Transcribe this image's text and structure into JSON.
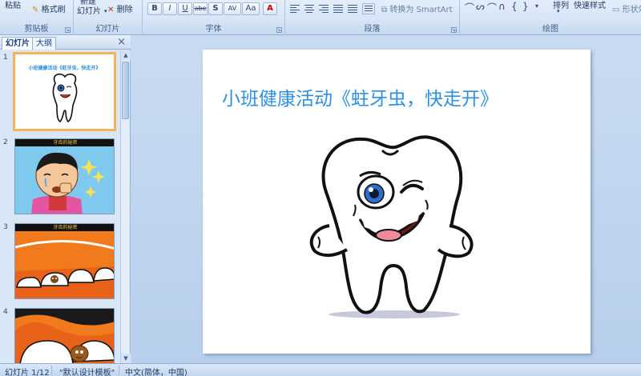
{
  "ribbon": {
    "clipboard": {
      "paste_label": "粘贴",
      "format_painter_label": "格式刷",
      "group_label": "剪贴板"
    },
    "slides": {
      "new_slide_label": "新建",
      "new_slide_label2": "幻灯片",
      "delete_label": "删除",
      "group_label": "幻灯片"
    },
    "font": {
      "group_label": "字体",
      "buttons": [
        "B",
        "I",
        "U",
        "abe",
        "S",
        "AV",
        "Aa",
        "A"
      ]
    },
    "paragraph": {
      "group_label": "段落",
      "smartart_label": "转换为 SmartArt"
    },
    "drawing": {
      "arrange_label": "排列",
      "quick_styles_label": "快速样式",
      "shape_effects_label": "形状效",
      "group_label": "绘图"
    }
  },
  "left_panel": {
    "tabs": [
      "幻灯片",
      "大纲"
    ],
    "close": "×",
    "thumbnails": [
      {
        "number": "1",
        "title": "小班健康活动《蛀牙虫，快走开》"
      },
      {
        "number": "2",
        "caption": "牙齿的秘密"
      },
      {
        "number": "3",
        "caption": "牙齿的秘密"
      },
      {
        "number": "4"
      }
    ]
  },
  "slide": {
    "title": "小班健康活动《蛀牙虫，快走开》"
  },
  "status_bar": {
    "slide_counter": "幻灯片 1/12",
    "theme": "\"默认设计模板\"",
    "language": "中文(简体，中国)"
  },
  "colors": {
    "title_blue": "#2e8fe0",
    "selection_orange": "#f4b35a",
    "ribbon_blue": "#d6e4f5"
  }
}
